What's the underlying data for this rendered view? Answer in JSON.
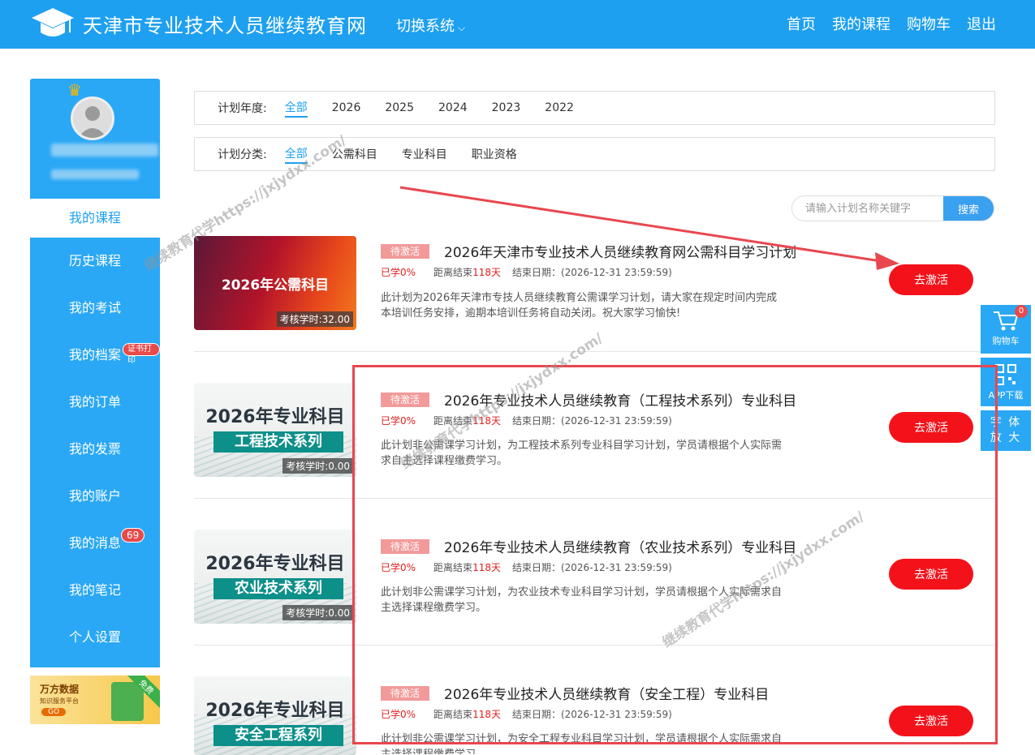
{
  "header": {
    "site_title": "天津市专业技术人员继续教育网",
    "switch_system": "切换系统",
    "nav": [
      "首页",
      "我的课程",
      "购物车",
      "退出"
    ]
  },
  "sidebar": {
    "active": "我的课程",
    "items": [
      {
        "label": "历史课程"
      },
      {
        "label": "我的考试"
      },
      {
        "label": "我的档案",
        "badge": "证书打印"
      },
      {
        "label": "我的订单"
      },
      {
        "label": "我的发票"
      },
      {
        "label": "我的账户"
      },
      {
        "label": "我的消息",
        "badge": "69"
      },
      {
        "label": "我的笔记"
      },
      {
        "label": "个人设置"
      }
    ],
    "ad": {
      "title": "万方数据",
      "subtitle": "知识服务平台",
      "go": "GO",
      "tag": "免费"
    }
  },
  "filters": {
    "year_label": "计划年度:",
    "years": [
      "全部",
      "2026",
      "2025",
      "2024",
      "2023",
      "2022"
    ],
    "category_label": "计划分类:",
    "categories": [
      "全部",
      "公需科目",
      "专业科目",
      "职业资格"
    ]
  },
  "search": {
    "placeholder": "请输入计划名称关键字",
    "button": "搜索"
  },
  "courses": [
    {
      "thumb_title": "2026年公需科目",
      "thumb_sub": "",
      "hours": "考核学时:32.00",
      "status": "待激活",
      "title": "2026年天津市专业技术人员继续教育网公需科目学习计划",
      "progress": "已学0%",
      "remaining": "距离结束",
      "days": "118天",
      "end_date": "结束日期：(2026-12-31 23:59:59)",
      "desc": "此计划为2026年天津市专技人员继续教育公需课学习计划，请大家在规定时间内完成本培训任务安排，逾期本培训任务将自动关闭。祝大家学习愉快!",
      "action": "去激活"
    },
    {
      "thumb_title": "2026年专业科目",
      "thumb_sub": "工程技术系列",
      "hours": "考核学时:0.00",
      "status": "待激活",
      "title": "2026年专业技术人员继续教育（工程技术系列）专业科目",
      "progress": "已学0%",
      "remaining": "距离结束",
      "days": "118天",
      "end_date": "结束日期：(2026-12-31 23:59:59)",
      "desc": "此计划非公需课学习计划，为工程技术系列专业科目学习计划，学员请根据个人实际需求自主选择课程缴费学习。",
      "action": "去激活"
    },
    {
      "thumb_title": "2026年专业科目",
      "thumb_sub": "农业技术系列",
      "hours": "考核学时:0.00",
      "status": "待激活",
      "title": "2026年专业技术人员继续教育（农业技术系列）专业科目",
      "progress": "已学0%",
      "remaining": "距离结束",
      "days": "118天",
      "end_date": "结束日期：(2026-12-31 23:59:59)",
      "desc": "此计划非公需课学习计划，为农业技术专业科目学习计划，学员请根据个人实际需求自主选择课程缴费学习。",
      "action": "去激活"
    },
    {
      "thumb_title": "2026年专业科目",
      "thumb_sub": "安全工程系列",
      "hours": "",
      "status": "待激活",
      "title": "2026年专业技术人员继续教育（安全工程）专业科目",
      "progress": "已学0%",
      "remaining": "距离结束",
      "days": "118天",
      "end_date": "结束日期：(2026-12-31 23:59:59)",
      "desc": "此计划非公需课学习计划，为安全工程专业科目学习计划，学员请根据个人实际需求自主选择课程缴费学习。",
      "action": "去激活"
    }
  ],
  "float_bar": {
    "cart": "购物车",
    "cart_count": "0",
    "app": "APP下载",
    "font": "字 体 放 大"
  },
  "watermarks": [
    "继续教育代学https://jxjydxx.com/",
    "继续教育代学https://jxjydxx.com/",
    "继续教育代学https://jxjydxx.com/"
  ],
  "colors": {
    "brand": "#1ea0f0",
    "sidebar": "#2aa8f5",
    "action": "#f4121a",
    "annotation": "#e8474f"
  }
}
